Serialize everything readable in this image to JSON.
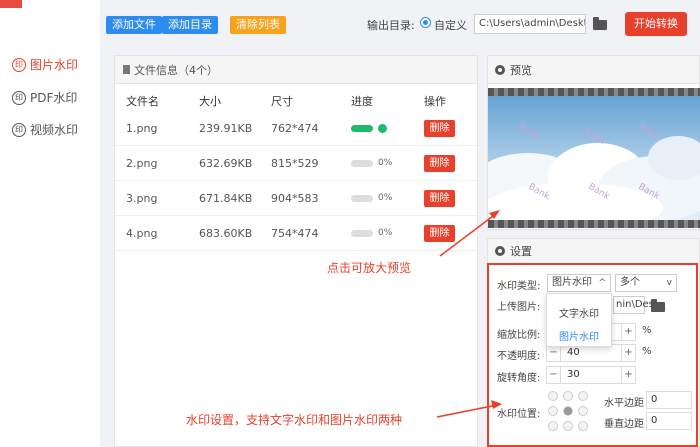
{
  "sidebar": {
    "items": [
      {
        "label": "图片水印",
        "active": true
      },
      {
        "label": "PDF水印",
        "active": false
      },
      {
        "label": "视频水印",
        "active": false
      }
    ]
  },
  "toolbar": {
    "add_file": "添加文件",
    "add_dir": "添加目录",
    "clear_list": "清除列表",
    "output_label": "输出目录:",
    "radio_label": "自定义",
    "output_path": "C:\\Users\\admin\\Deskto",
    "start": "开始转换"
  },
  "file_panel": {
    "title": "文件信息（4个）",
    "columns": [
      "文件名",
      "大小",
      "尺寸",
      "进度",
      "操作"
    ],
    "rows": [
      {
        "name": "1.png",
        "size": "239.91KB",
        "dims": "762*474",
        "progress": "",
        "delete": "删除"
      },
      {
        "name": "2.png",
        "size": "632.69KB",
        "dims": "815*529",
        "progress": "0%",
        "delete": "删除"
      },
      {
        "name": "3.png",
        "size": "671.84KB",
        "dims": "904*583",
        "progress": "0%",
        "delete": "删除"
      },
      {
        "name": "4.png",
        "size": "683.60KB",
        "dims": "754*474",
        "progress": "0%",
        "delete": "删除"
      }
    ]
  },
  "preview": {
    "title": "预览",
    "watermark_text": "Bank"
  },
  "settings": {
    "title": "设置",
    "type_label": "水印类型:",
    "type_value": "图片水印",
    "count_value": "多个",
    "upload_label": "上传图片:",
    "upload_value": "nin\\Des",
    "dropdown_options": [
      "文字水印",
      "图片水印"
    ],
    "scale_label": "缩放比例:",
    "opacity_label": "不透明度:",
    "opacity_value": "40",
    "rotate_label": "旋转角度:",
    "rotate_value": "30",
    "minus": "−",
    "plus": "+",
    "percent": "%",
    "position_label": "水印位置:",
    "h_margin_label": "水平边距",
    "h_margin_value": "0",
    "v_margin_label": "垂直边距",
    "v_margin_value": "0"
  },
  "annotations": {
    "preview_hint": "点击可放大预览",
    "settings_hint": "水印设置，支持文字水印和图片水印两种"
  },
  "colors": {
    "accent_red": "#e8402a",
    "blue": "#2d8cf0",
    "orange": "#f7a21b",
    "green": "#19be6b"
  }
}
